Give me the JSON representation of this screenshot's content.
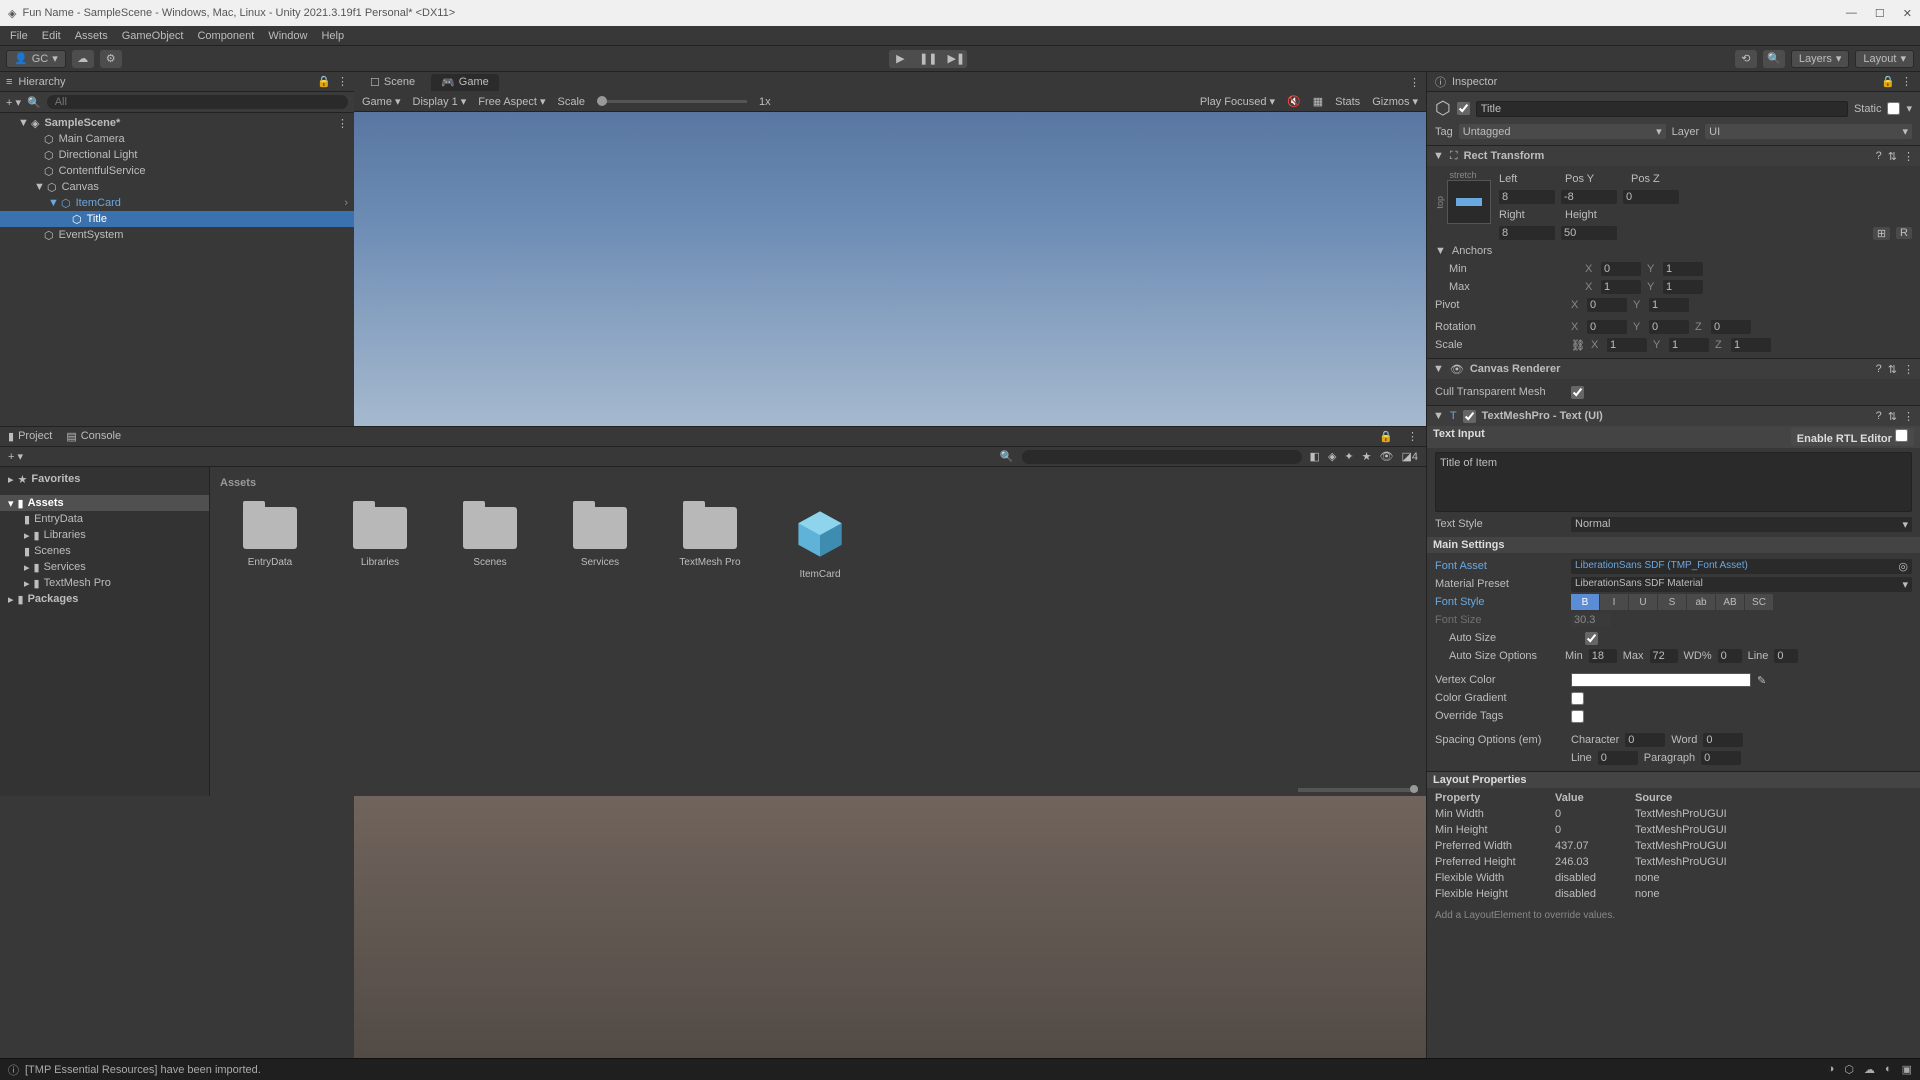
{
  "titlebar": {
    "text": "Fun Name - SampleScene - Windows, Mac, Linux - Unity 2021.3.19f1 Personal* <DX11>"
  },
  "menu": [
    "File",
    "Edit",
    "Assets",
    "GameObject",
    "Component",
    "Window",
    "Help"
  ],
  "toolbar": {
    "gc": "GC",
    "layers": "Layers",
    "layout": "Layout"
  },
  "hierarchy": {
    "title": "Hierarchy",
    "search_ph": "All",
    "scene": "SampleScene*",
    "nodes": [
      "Main Camera",
      "Directional Light",
      "ContentfulService",
      "Canvas",
      "ItemCard",
      "Title",
      "EventSystem"
    ]
  },
  "gametabs": {
    "scene": "Scene",
    "game": "Game"
  },
  "gamebar": {
    "game": "Game",
    "display": "Display 1",
    "aspect": "Free Aspect",
    "scale": "Scale",
    "scaleval": "1x",
    "play": "Play Focused",
    "stats": "Stats",
    "gizmos": "Gizmos"
  },
  "card": {
    "title": "Title of Item"
  },
  "project": {
    "tab1": "Project",
    "tab2": "Console",
    "layers_count": "4",
    "folders": {
      "fav": "Favorites",
      "assets": "Assets",
      "entry": "EntryData",
      "lib": "Libraries",
      "scenes": "Scenes",
      "services": "Services",
      "tmp": "TextMesh Pro",
      "packages": "Packages"
    },
    "assets_hdr": "Assets",
    "items": [
      "EntryData",
      "Libraries",
      "Scenes",
      "Services",
      "TextMesh Pro",
      "ItemCard"
    ]
  },
  "inspector": {
    "title": "Inspector",
    "name": "Title",
    "static": "Static",
    "tag_l": "Tag",
    "tag_v": "Untagged",
    "layer_l": "Layer",
    "layer_v": "UI",
    "rect": {
      "title": "Rect Transform",
      "stretch": "stretch",
      "top": "top",
      "left_l": "Left",
      "left_v": "8",
      "posy_l": "Pos Y",
      "posy_v": "-8",
      "posz_l": "Pos Z",
      "posz_v": "0",
      "right_l": "Right",
      "right_v": "8",
      "h_l": "Height",
      "h_v": "50",
      "anchors": "Anchors",
      "min": "Min",
      "max": "Max",
      "pivot": "Pivot",
      "min_x": "0",
      "min_y": "1",
      "max_x": "1",
      "max_y": "1",
      "piv_x": "0",
      "piv_y": "1",
      "rot": "Rotation",
      "rot_x": "0",
      "rot_y": "0",
      "rot_z": "0",
      "scale": "Scale",
      "sc_x": "1",
      "sc_y": "1",
      "sc_z": "1"
    },
    "canvasrend": {
      "title": "Canvas Renderer",
      "cull": "Cull Transparent Mesh"
    },
    "tmp": {
      "title": "TextMeshPro - Text (UI)",
      "textinput": "Text Input",
      "rtl": "Enable RTL Editor",
      "textval": "Title of Item",
      "textstyle_l": "Text Style",
      "textstyle_v": "Normal",
      "mainset": "Main Settings",
      "fontasset_l": "Font Asset",
      "fontasset_v": "LiberationSans SDF (TMP_Font Asset)",
      "matpreset_l": "Material Preset",
      "matpreset_v": "LiberationSans SDF Material",
      "fontstyle_l": "Font Style",
      "styles": [
        "B",
        "I",
        "U",
        "S",
        "ab",
        "AB",
        "SC"
      ],
      "fontsize_l": "Font Size",
      "fontsize_v": "30.3",
      "autosize_l": "Auto Size",
      "autoopt_l": "Auto Size Options",
      "min_l": "Min",
      "min_v": "18",
      "max_l": "Max",
      "max_v": "72",
      "wd_l": "WD%",
      "wd_v": "0",
      "line_l": "Line",
      "line_v": "0",
      "vcolor_l": "Vertex Color",
      "cgrad_l": "Color Gradient",
      "otags_l": "Override Tags",
      "spacing_l": "Spacing Options (em)",
      "char_l": "Character",
      "char_v": "0",
      "word_l": "Word",
      "word_v": "0",
      "line2_l": "Line",
      "line2_v": "0",
      "para_l": "Paragraph",
      "para_v": "0"
    },
    "layoutprop": {
      "title": "Layout Properties",
      "hdr_prop": "Property",
      "hdr_val": "Value",
      "hdr_src": "Source",
      "rows": [
        {
          "p": "Min Width",
          "v": "0",
          "s": "TextMeshProUGUI"
        },
        {
          "p": "Min Height",
          "v": "0",
          "s": "TextMeshProUGUI"
        },
        {
          "p": "Preferred Width",
          "v": "437.07",
          "s": "TextMeshProUGUI"
        },
        {
          "p": "Preferred Height",
          "v": "246.03",
          "s": "TextMeshProUGUI"
        },
        {
          "p": "Flexible Width",
          "v": "disabled",
          "s": "none"
        },
        {
          "p": "Flexible Height",
          "v": "disabled",
          "s": "none"
        }
      ],
      "hint": "Add a LayoutElement to override values."
    }
  },
  "status": {
    "msg": "[TMP Essential Resources] have been imported."
  },
  "blueprint_btn1": "⊞",
  "blueprint_btn2": "R"
}
